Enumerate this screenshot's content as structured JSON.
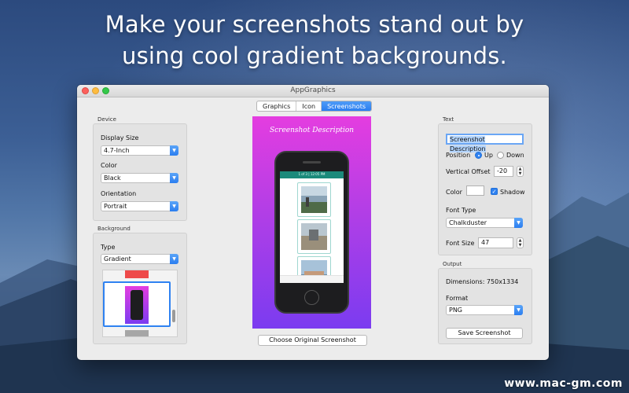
{
  "promo": {
    "line1": "Make your screenshots stand out by",
    "line2": "using cool gradient backgrounds."
  },
  "window": {
    "title": "AppGraphics"
  },
  "tabs": [
    {
      "label": "Graphics",
      "active": false
    },
    {
      "label": "Icon",
      "active": false
    },
    {
      "label": "Screenshots",
      "active": true
    }
  ],
  "device": {
    "section_label": "Device",
    "display_size_label": "Display Size",
    "display_size_value": "4.7-Inch",
    "color_label": "Color",
    "color_value": "Black",
    "orientation_label": "Orientation",
    "orientation_value": "Portrait"
  },
  "background": {
    "section_label": "Background",
    "type_label": "Type",
    "type_value": "Gradient"
  },
  "preview": {
    "caption": "Screenshot Description",
    "status_text": "1 of 3 | 12:05 PM",
    "choose_button": "Choose Original Screenshot"
  },
  "text_panel": {
    "section_label": "Text",
    "description_value": "Screenshot Description",
    "position_label": "Position",
    "position_up": "Up",
    "position_down": "Down",
    "position_selected": "Up",
    "vertical_offset_label": "Vertical Offset",
    "vertical_offset_value": "-20",
    "color_label": "Color",
    "shadow_label": "Shadow",
    "shadow_checked": true,
    "font_type_label": "Font Type",
    "font_type_value": "Chalkduster",
    "font_size_label": "Font Size",
    "font_size_value": "47"
  },
  "output": {
    "section_label": "Output",
    "dimensions_text": "Dimensions:  750x1334",
    "format_label": "Format",
    "format_value": "PNG",
    "save_button": "Save Screenshot"
  },
  "watermark": "www.mac-gm.com",
  "colors": {
    "accent": "#2f82f1",
    "gradient_top": "#e43de0",
    "gradient_bottom": "#7b3cf0",
    "phone_body": "#1d1d1f",
    "app_bar": "#1b8a7b"
  }
}
